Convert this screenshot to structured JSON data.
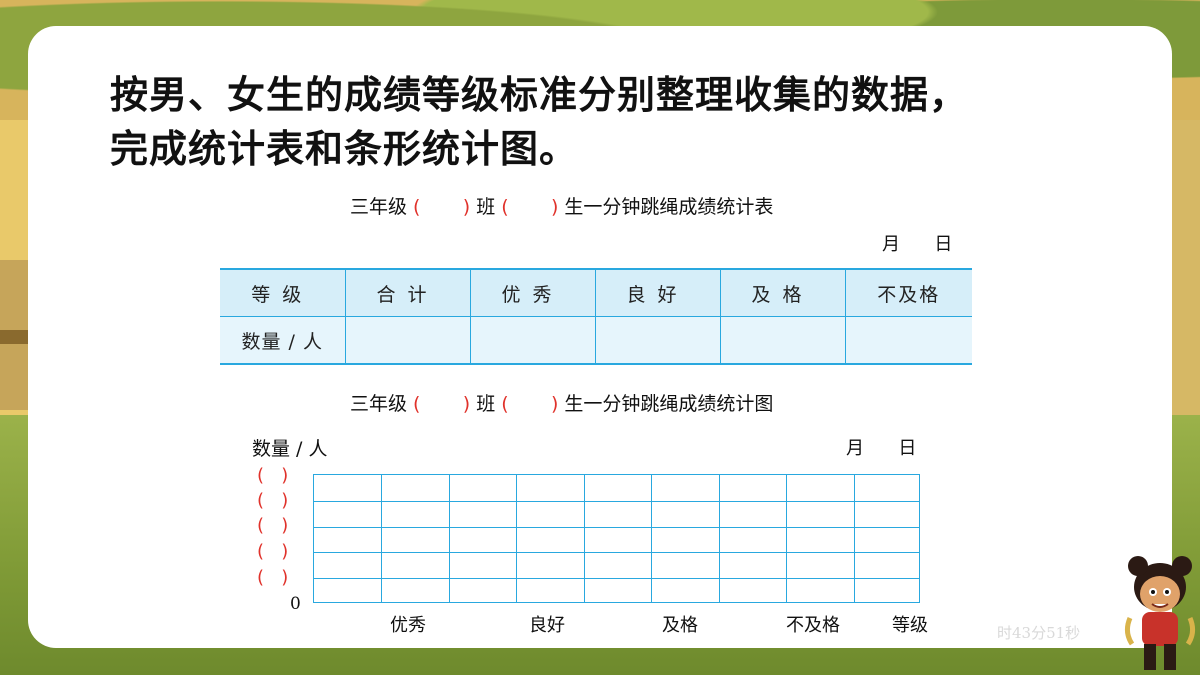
{
  "slide": {
    "title_line1": "按男、女生的成绩等级标准分别整理收集的数据，",
    "title_line2": "完成统计表和条形统计图。"
  },
  "table_caption": {
    "part1": "三年级",
    "part2": "班",
    "part3": "生一分钟跳绳成绩统计表",
    "paren_open": "(",
    "paren_close": ")"
  },
  "table_date": "月      日",
  "table": {
    "headers": [
      "等级",
      "合计",
      "优秀",
      "良好",
      "及格",
      "不及格"
    ],
    "row_label": "数量 / 人",
    "row_values": [
      "",
      "",
      "",
      "",
      ""
    ]
  },
  "chart_caption": {
    "part1": "三年级",
    "part2": "班",
    "part3": "生一分钟跳绳成绩统计图"
  },
  "chart_date": "月      日",
  "chart_data": {
    "type": "bar",
    "ylabel": "数量 / 人",
    "xlabel": "等级",
    "categories": [
      "优秀",
      "良好",
      "及格",
      "不及格"
    ],
    "values": [],
    "y_tick_placeholders": [
      "(   )",
      "(   )",
      "(   )",
      "(   )",
      "(   )"
    ],
    "y_origin": "0",
    "grid": true
  },
  "watermark": "时43分51秒"
}
